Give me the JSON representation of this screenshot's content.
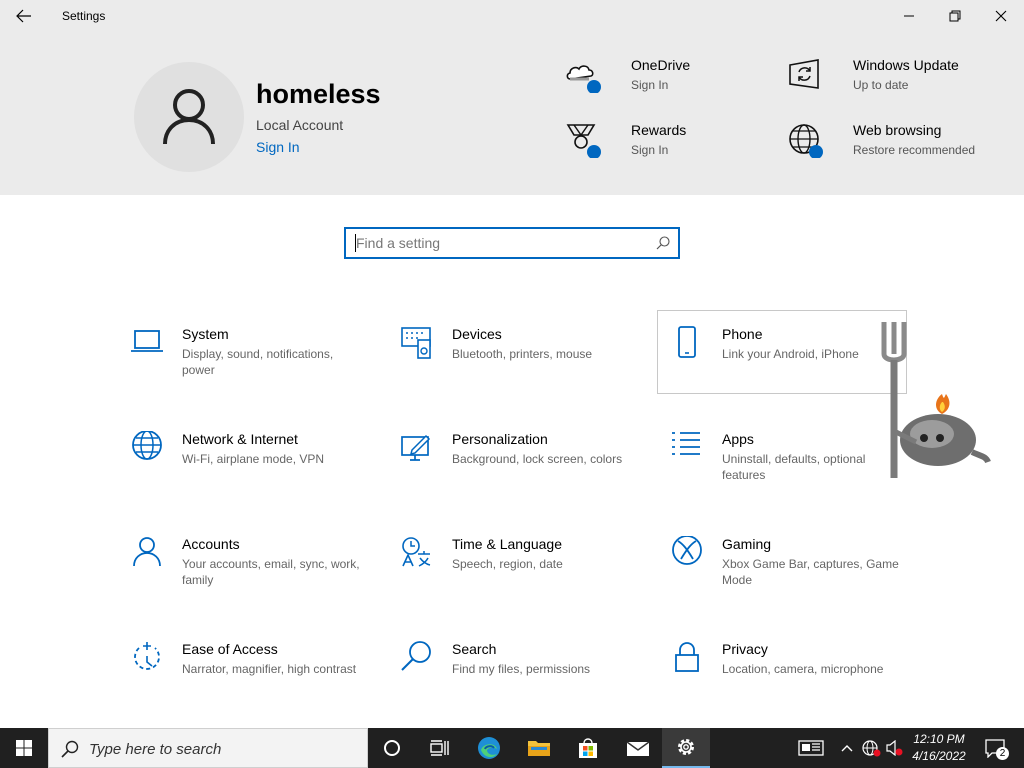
{
  "window": {
    "title": "Settings",
    "back_icon": "back-arrow-icon",
    "controls": [
      "minimize-icon",
      "restore-icon",
      "close-icon"
    ]
  },
  "account": {
    "name": "homeless",
    "type": "Local Account",
    "sign_in": "Sign In"
  },
  "header_items": [
    {
      "title": "OneDrive",
      "subtitle": "Sign In",
      "icon": "onedrive-icon"
    },
    {
      "title": "Windows Update",
      "subtitle": "Up to date",
      "icon": "windows-update-icon"
    },
    {
      "title": "Rewards",
      "subtitle": "Sign In",
      "icon": "rewards-icon"
    },
    {
      "title": "Web browsing",
      "subtitle": "Restore recommended",
      "icon": "web-browsing-icon"
    }
  ],
  "search": {
    "placeholder": "Find a setting"
  },
  "categories": [
    {
      "title": "System",
      "subtitle": "Display, sound, notifications, power",
      "icon": "laptop-icon"
    },
    {
      "title": "Devices",
      "subtitle": "Bluetooth, printers, mouse",
      "icon": "devices-icon"
    },
    {
      "title": "Phone",
      "subtitle": "Link your Android, iPhone",
      "icon": "phone-icon"
    },
    {
      "title": "Network & Internet",
      "subtitle": "Wi-Fi, airplane mode, VPN",
      "icon": "globe-icon"
    },
    {
      "title": "Personalization",
      "subtitle": "Background, lock screen, colors",
      "icon": "personalization-icon"
    },
    {
      "title": "Apps",
      "subtitle": "Uninstall, defaults, optional features",
      "icon": "apps-list-icon"
    },
    {
      "title": "Accounts",
      "subtitle": "Your accounts, email, sync, work, family",
      "icon": "person-icon"
    },
    {
      "title": "Time & Language",
      "subtitle": "Speech, region, date",
      "icon": "time-language-icon"
    },
    {
      "title": "Gaming",
      "subtitle": "Xbox Game Bar, captures, Game Mode",
      "icon": "xbox-icon"
    },
    {
      "title": "Ease of Access",
      "subtitle": "Narrator, magnifier, high contrast",
      "icon": "ease-of-access-icon"
    },
    {
      "title": "Search",
      "subtitle": "Find my files, permissions",
      "icon": "search-icon"
    },
    {
      "title": "Privacy",
      "subtitle": "Location, camera, microphone",
      "icon": "lock-icon"
    }
  ],
  "taskbar": {
    "search_placeholder": "Type here to search",
    "clock_time": "12:10 PM",
    "clock_date": "4/16/2022",
    "notification_count": "2"
  },
  "colors": {
    "accent": "#0067c0",
    "taskbar": "#202020",
    "header_bg": "#ebebeb"
  }
}
